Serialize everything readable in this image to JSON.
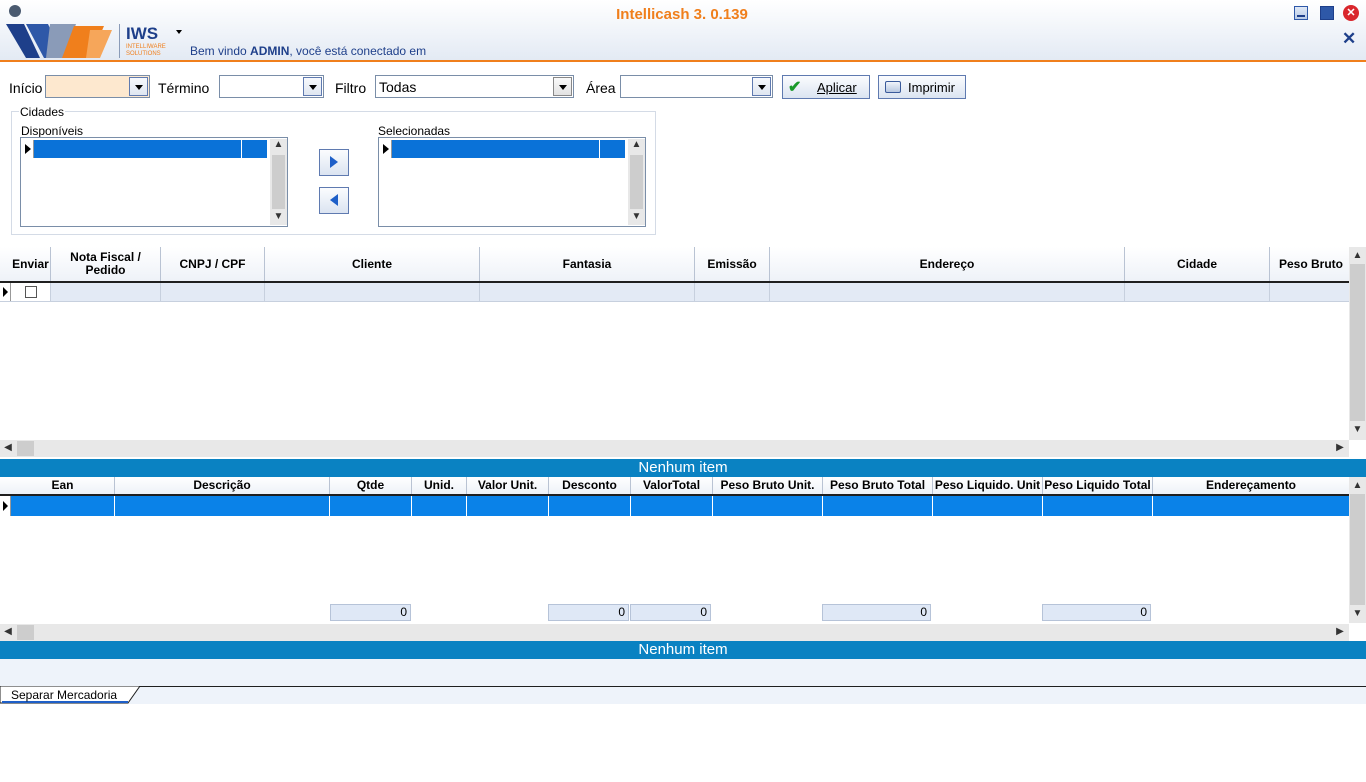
{
  "app": {
    "title": "Intellicash 3. 0.139",
    "logo_text": "IWS",
    "logo_sub": "INTELLIWARE SOLUTIONS",
    "welcome_prefix": "Bem vindo ",
    "welcome_user": "ADMIN",
    "welcome_suffix": ", você está conectado em",
    "accent": "#f07f1c",
    "brand_blue": "#1e3f8a"
  },
  "filters": {
    "start_label": "Início",
    "start_value": "",
    "end_label": "Término",
    "end_value": "",
    "filter_label": "Filtro",
    "filter_value": "Todas",
    "area_label": "Área",
    "area_value": "",
    "apply_label": "Aplicar",
    "print_label": "Imprimir"
  },
  "cities": {
    "group_label": "Cidades",
    "available_label": "Disponíveis",
    "selected_label": "Selecionadas",
    "move_right_icon": "arrow-right-icon",
    "move_left_icon": "arrow-left-icon"
  },
  "orders_grid": {
    "columns": [
      "Enviar",
      "Nota Fiscal / Pedido",
      "CNPJ / CPF",
      "Cliente",
      "Fantasia",
      "Emissão",
      "Endereço",
      "Cidade",
      "Peso Bruto"
    ],
    "status": "Nenhum item"
  },
  "items_grid": {
    "columns": [
      "Ean",
      "Descrição",
      "Qtde",
      "Unid.",
      "Valor Unit.",
      "Desconto",
      "ValorTotal",
      "Peso Bruto Unit.",
      "Peso Bruto Total",
      "Peso Liquido. Unit",
      "Peso Liquido Total",
      "Endereçamento"
    ],
    "totals": {
      "qtde": "0",
      "desconto": "0",
      "valor_total": "0",
      "peso_bruto_total": "0",
      "peso_liquido_total": "0"
    },
    "status": "Nenhum item"
  },
  "tabs": [
    "Separar Mercadoria"
  ]
}
